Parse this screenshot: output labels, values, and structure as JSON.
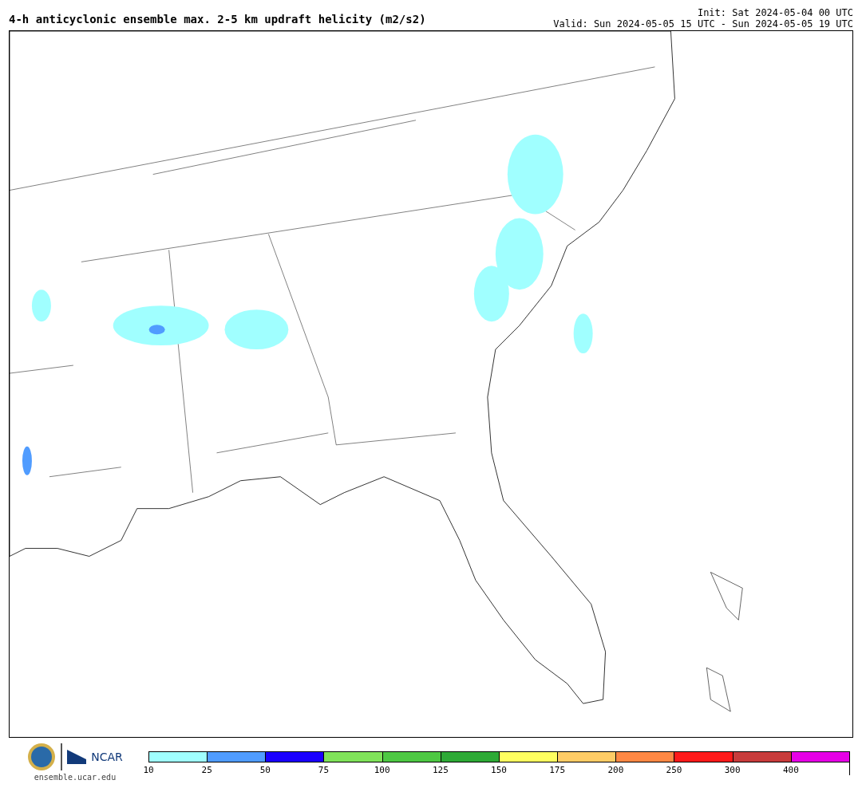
{
  "title": "4-h anticyclonic ensemble max. 2-5 km updraft helicity (m2/s2)",
  "init": "Init: Sat 2024-05-04 00 UTC",
  "valid": "Valid: Sun 2024-05-05 15 UTC - Sun 2024-05-05 19 UTC",
  "footer": {
    "logo_text": "NCAR",
    "url": "ensemble.ucar.edu"
  },
  "legend": [
    {
      "label": "10",
      "color": "#a0ffff"
    },
    {
      "label": "25",
      "color": "#509cff"
    },
    {
      "label": "50",
      "color": "#1a00ff"
    },
    {
      "label": "75",
      "color": "#80e35a"
    },
    {
      "label": "100",
      "color": "#4ec843"
    },
    {
      "label": "125",
      "color": "#2eaa36"
    },
    {
      "label": "150",
      "color": "#ffff60"
    },
    {
      "label": "175",
      "color": "#ffcc66"
    },
    {
      "label": "200",
      "color": "#ff8844"
    },
    {
      "label": "250",
      "color": "#ff1a1a"
    },
    {
      "label": "300",
      "color": "#c83c3c"
    },
    {
      "label": "400",
      "color": "#e600e6"
    }
  ]
}
